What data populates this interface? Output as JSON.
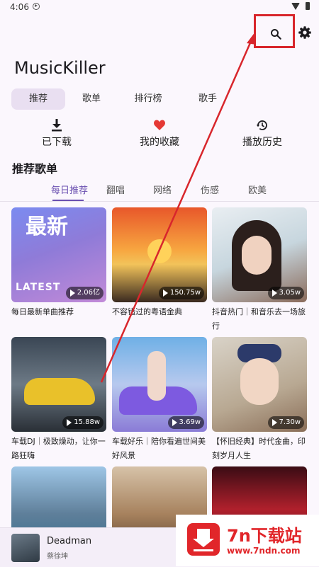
{
  "status_bar": {
    "time": "4:06"
  },
  "header": {
    "title": "MusicKiller",
    "search_icon": "search-icon",
    "settings_icon": "gear-icon"
  },
  "main_tabs": [
    {
      "label": "推荐",
      "active": true
    },
    {
      "label": "歌单",
      "active": false
    },
    {
      "label": "排行榜",
      "active": false
    },
    {
      "label": "歌手",
      "active": false
    }
  ],
  "quick_actions": [
    {
      "label": "已下载",
      "icon": "download-icon"
    },
    {
      "label": "我的收藏",
      "icon": "heart-icon"
    },
    {
      "label": "播放历史",
      "icon": "history-icon"
    }
  ],
  "section": {
    "title": "推荐歌单"
  },
  "playlist_tabs": [
    {
      "label": "每日推荐",
      "active": true
    },
    {
      "label": "翻唱",
      "active": false
    },
    {
      "label": "网络",
      "active": false
    },
    {
      "label": "伤感",
      "active": false
    },
    {
      "label": "欧美",
      "active": false
    }
  ],
  "playlists": [
    {
      "title": "每日最新单曲推荐",
      "plays": "2.06亿",
      "cover_text": "最新",
      "cover_sub": "LATEST"
    },
    {
      "title": "不容错过的粤语金典",
      "plays": "150.75w"
    },
    {
      "title": "抖音热门｜和音乐去一场旅行",
      "plays": "3.05w"
    },
    {
      "title": "车载DJ｜极致燥动，让你一路狂嗨",
      "plays": "15.88w"
    },
    {
      "title": "车载好乐｜陪你看遍世间美好风景",
      "plays": "3.69w"
    },
    {
      "title": "【怀旧经典】时代金曲，印刻岁月人生",
      "plays": "7.30w"
    },
    {
      "title": "",
      "plays": ""
    },
    {
      "title": "",
      "plays": ""
    },
    {
      "title": "",
      "plays": ""
    }
  ],
  "mini_player": {
    "song": "Deadman",
    "artist": "蔡徐坤"
  },
  "watermark": {
    "title": "7n下载站",
    "url": "www.7ndn.com"
  },
  "colors": {
    "accent": "#6a4fb0",
    "highlight": "#d8262c",
    "heart": "#e53935"
  }
}
